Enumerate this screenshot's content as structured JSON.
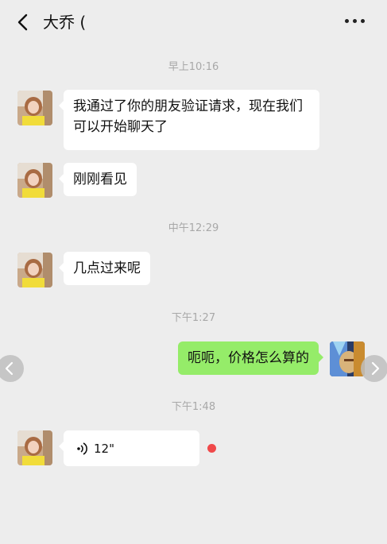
{
  "header": {
    "title": "大乔 (",
    "back_icon": "back-chevron-icon",
    "more_icon": "more-dots-icon"
  },
  "messages": [
    {
      "type": "time",
      "text": "早上10:16"
    },
    {
      "type": "received",
      "text": "我通过了你的朋友验证请求，现在我们可以开始聊天了"
    },
    {
      "type": "received",
      "text": "刚刚看见"
    },
    {
      "type": "time",
      "text": "中午12:29"
    },
    {
      "type": "received",
      "text": "几点过来呢"
    },
    {
      "type": "time",
      "text": "下午1:27"
    },
    {
      "type": "sent",
      "text": "呃呃，价格怎么算的"
    },
    {
      "type": "time",
      "text": "下午1:48"
    },
    {
      "type": "voice",
      "duration": "12\"",
      "unread": true
    }
  ],
  "colors": {
    "background": "#ededed",
    "sent_bubble": "#95ec69",
    "received_bubble": "#ffffff",
    "unread_dot": "#f0494a"
  },
  "overlay": {
    "left_arrow_icon": "chevron-left-icon",
    "right_arrow_icon": "chevron-right-icon"
  }
}
